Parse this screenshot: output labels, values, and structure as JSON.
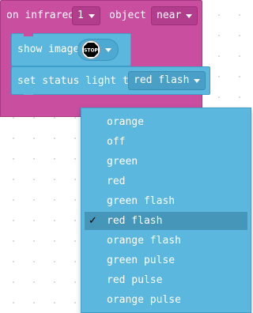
{
  "event_block": {
    "label_on": "on infrared",
    "sensor_value": "1",
    "label_object": "object",
    "distance_value": "near"
  },
  "show_image_block": {
    "label": "show image",
    "image_text": "STOP"
  },
  "status_light_block": {
    "label": "set status light to",
    "value": "red flash"
  },
  "dropdown_menu": {
    "selected_mark": "✓",
    "items": [
      "orange",
      "off",
      "green",
      "red",
      "green flash",
      "red flash",
      "orange flash",
      "green pulse",
      "red pulse",
      "orange pulse"
    ],
    "selected_index": 5
  },
  "colors": {
    "event_block": "#c94ea0",
    "action_block": "#5bb7de",
    "highlight": "#4596b9"
  }
}
